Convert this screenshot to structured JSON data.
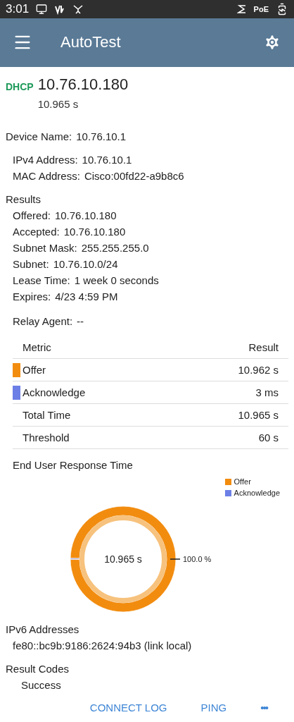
{
  "status_bar": {
    "time": "3:01",
    "poe": "PoE"
  },
  "app_bar": {
    "title": "AutoTest"
  },
  "header": {
    "protocol": "DHCP",
    "address": "10.76.10.180",
    "duration": "10.965 s"
  },
  "device": {
    "label": "Device Name:",
    "value": "10.76.10.1",
    "fields": [
      {
        "label": "IPv4 Address:",
        "value": "10.76.10.1"
      },
      {
        "label": "MAC Address:",
        "value": "Cisco:00fd22-a9b8c6"
      }
    ]
  },
  "results": {
    "title": "Results",
    "fields": [
      {
        "label": "Offered:",
        "value": "10.76.10.180"
      },
      {
        "label": "Accepted:",
        "value": "10.76.10.180"
      },
      {
        "label": "Subnet Mask:",
        "value": "255.255.255.0"
      },
      {
        "label": "Subnet:",
        "value": "10.76.10.0/24"
      },
      {
        "label": "Lease Time:",
        "value": "1 week 0 seconds"
      },
      {
        "label": "Expires:",
        "value": "4/23 4:59 PM"
      }
    ]
  },
  "relay_agent": {
    "label": "Relay Agent:",
    "value": "--"
  },
  "table": {
    "columns": [
      "Metric",
      "Result"
    ],
    "rows": [
      {
        "metric": "Offer",
        "result": "10.962 s",
        "color": "#f28c0f"
      },
      {
        "metric": "Acknowledge",
        "result": "3 ms",
        "color": "#6c7fe6"
      },
      {
        "metric": "Total Time",
        "result": "10.965 s"
      },
      {
        "metric": "Threshold",
        "result": "60 s"
      }
    ]
  },
  "response_chart": {
    "title": "End User Response Time",
    "center_label": "10.965 s",
    "legend": [
      {
        "color": "#f28c0f"
      },
      {
        "color": "#6c7fe6"
      }
    ],
    "chart_data": {
      "type": "donut",
      "categories": [
        "Offer",
        "Acknowledge"
      ],
      "values": [
        99.97,
        0.03
      ],
      "annotations": [
        "100.0 %"
      ]
    }
  },
  "ipv6": {
    "title": "IPv6 Addresses",
    "addresses": [
      "fe80::bc9b:9186:2624:94b3 (link local)"
    ]
  },
  "result_codes": {
    "title": "Result Codes",
    "codes": [
      "Success"
    ]
  },
  "actions": [
    {
      "kind": "text",
      "label": "CONNECT LOG"
    },
    {
      "kind": "text",
      "label": "PING"
    },
    {
      "kind": "more",
      "label": "•••"
    }
  ]
}
